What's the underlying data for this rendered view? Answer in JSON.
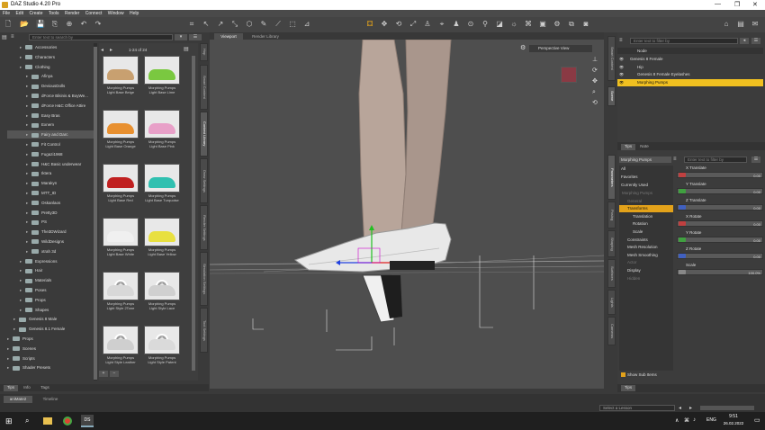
{
  "window": {
    "title": "DAZ Studio 4.20 Pro"
  },
  "menu": [
    "File",
    "Edit",
    "Create",
    "Tools",
    "Render",
    "Connect",
    "Window",
    "Help"
  ],
  "content_library": {
    "search_placeholder": "Enter text to search by",
    "tree": [
      {
        "label": "Accessories",
        "indent": 1,
        "sel": false
      },
      {
        "label": "Characters",
        "indent": 1,
        "sel": false
      },
      {
        "label": "Clothing",
        "indent": 1,
        "sel": false
      },
      {
        "label": "Afinya",
        "indent": 2,
        "sel": false
      },
      {
        "label": "DeviousDolls",
        "indent": 2,
        "sel": false
      },
      {
        "label": "dForce Bikinis & BoyWe...",
        "indent": 2,
        "sel": false
      },
      {
        "label": "dForce H&C Office Attire",
        "indent": 2,
        "sel": false
      },
      {
        "label": "Easy Bras",
        "indent": 2,
        "sel": false
      },
      {
        "label": "Exnem",
        "indent": 2,
        "sel": false
      },
      {
        "label": "Fairy and Darc",
        "indent": 2,
        "sel": true
      },
      {
        "label": "Fit Control",
        "indent": 2,
        "sel": false
      },
      {
        "label": "Fugazi1968",
        "indent": 2,
        "sel": false
      },
      {
        "label": "H&C Basic underwear",
        "indent": 2,
        "sel": false
      },
      {
        "label": "Iktera",
        "indent": 2,
        "sel": false
      },
      {
        "label": "Marakyn",
        "indent": 2,
        "sel": false
      },
      {
        "label": "MTT_ID",
        "indent": 2,
        "sel": false
      },
      {
        "label": "Oskanlaos",
        "indent": 2,
        "sel": false
      },
      {
        "label": "Pretty3D",
        "indent": 2,
        "sel": false
      },
      {
        "label": "PS",
        "indent": 2,
        "sel": false
      },
      {
        "label": "The3DWizard",
        "indent": 2,
        "sel": false
      },
      {
        "label": "WildDesigns",
        "indent": 2,
        "sel": false
      },
      {
        "label": "xtrah 3d",
        "indent": 2,
        "sel": false
      },
      {
        "label": "Expressions",
        "indent": 1,
        "sel": false
      },
      {
        "label": "Hair",
        "indent": 1,
        "sel": false
      },
      {
        "label": "Materials",
        "indent": 1,
        "sel": false
      },
      {
        "label": "Poses",
        "indent": 1,
        "sel": false
      },
      {
        "label": "Props",
        "indent": 1,
        "sel": false
      },
      {
        "label": "Shapes",
        "indent": 1,
        "sel": false
      },
      {
        "label": "Genesis 8 Male",
        "indent": 0,
        "sel": false
      },
      {
        "label": "Genesis 8.1 Female",
        "indent": 0,
        "sel": false
      },
      {
        "label": "Props",
        "indent": -1,
        "sel": false
      },
      {
        "label": "Scenes",
        "indent": -1,
        "sel": false
      },
      {
        "label": "Scripts",
        "indent": -1,
        "sel": false
      },
      {
        "label": "Shader Presets",
        "indent": -1,
        "sel": false
      }
    ],
    "page_info": "1-24 of 24",
    "items": [
      {
        "line1": "Morphing Pumps",
        "line2": "Light Base Beige",
        "color": "#c8a070"
      },
      {
        "line1": "Morphing Pumps",
        "line2": "Light Base Lime",
        "color": "#7ac840"
      },
      {
        "line1": "Morphing Pumps",
        "line2": "Light Base Orange",
        "color": "#e89030"
      },
      {
        "line1": "Morphing Pumps",
        "line2": "Light Base Pink",
        "color": "#e8a0c8"
      },
      {
        "line1": "Morphing Pumps",
        "line2": "Light Base Red",
        "color": "#c02020"
      },
      {
        "line1": "Morphing Pumps",
        "line2": "Light Base Turquoise",
        "color": "#30c0b0"
      },
      {
        "line1": "Morphing Pumps",
        "line2": "Light Base White",
        "color": "#f0f0f0"
      },
      {
        "line1": "Morphing Pumps",
        "line2": "Light Base Yellow",
        "color": "#e8e040"
      },
      {
        "line1": "Morphing Pumps",
        "line2": "Light Style 2Tone",
        "color": "#d8d8d8"
      },
      {
        "line1": "Morphing Pumps",
        "line2": "Light Style Lace",
        "color": "#d0d0d0"
      },
      {
        "line1": "Morphing Pumps",
        "line2": "Light Style Leather",
        "color": "#cfcfcf"
      },
      {
        "line1": "Morphing Pumps",
        "line2": "Light Style Patent",
        "color": "#dadada"
      }
    ],
    "bottom_tabs": [
      "Tips",
      "Info",
      "Tags"
    ]
  },
  "side_tabs_left": [
    "Smart Content",
    "Content Library",
    "Draw Settings",
    "Render Settings",
    "Simulation Settings",
    "Tool Settings"
  ],
  "viewport": {
    "tabs": [
      "Viewport",
      "Render Library"
    ],
    "view_label": "Perspective View"
  },
  "scene": {
    "search_placeholder": "Enter text to filter by",
    "header": "Node",
    "nodes": [
      {
        "label": "Genesis 8 Female",
        "indent": 0,
        "sel": false
      },
      {
        "label": "Hip",
        "indent": 1,
        "sel": false
      },
      {
        "label": "Genesis 8 Female Eyelashes",
        "indent": 1,
        "sel": false
      },
      {
        "label": "Morphing Pumps",
        "indent": 1,
        "sel": true
      }
    ],
    "tabs": [
      "Tips",
      "Note"
    ]
  },
  "parameters": {
    "node_selector": "Morphing Pumps",
    "search_placeholder": "Enter text to filter by",
    "categories": [
      "All",
      "Favorites",
      "Currently Used"
    ],
    "tree": [
      {
        "label": "Morphing Pumps",
        "indent": 0,
        "sel": false,
        "dim": true
      },
      {
        "label": "General",
        "indent": 1,
        "sel": false,
        "dim": true
      },
      {
        "label": "Transforms",
        "indent": 1,
        "sel": true,
        "dim": false
      },
      {
        "label": "Translation",
        "indent": 2,
        "sel": false,
        "dim": false
      },
      {
        "label": "Rotation",
        "indent": 2,
        "sel": false,
        "dim": false
      },
      {
        "label": "Scale",
        "indent": 2,
        "sel": false,
        "dim": false
      },
      {
        "label": "Constraints",
        "indent": 1,
        "sel": false,
        "dim": false
      },
      {
        "label": "Mesh Resolution",
        "indent": 1,
        "sel": false,
        "dim": false
      },
      {
        "label": "Mesh Smoothing",
        "indent": 1,
        "sel": false,
        "dim": false
      },
      {
        "label": "Actor",
        "indent": 1,
        "sel": false,
        "dim": true
      },
      {
        "label": "Display",
        "indent": 1,
        "sel": false,
        "dim": false
      },
      {
        "label": "Hidden",
        "indent": 1,
        "sel": false,
        "dim": true
      }
    ],
    "sliders": [
      {
        "label": "X Translate",
        "value": "0.00",
        "color": "#c04040"
      },
      {
        "label": "Y Translate",
        "value": "0.00",
        "color": "#40a040"
      },
      {
        "label": "Z Translate",
        "value": "0.00",
        "color": "#4060c0"
      },
      {
        "label": "X Rotate",
        "value": "0.00",
        "color": "#c04040"
      },
      {
        "label": "Y Rotate",
        "value": "0.00",
        "color": "#40a040"
      },
      {
        "label": "Z Rotate",
        "value": "0.00",
        "color": "#4060c0"
      },
      {
        "label": "Scale",
        "value": "100.0%",
        "color": "#888888"
      }
    ],
    "show_sub_items": "Show Sub Items",
    "tab": "Tips"
  },
  "side_tabs_right": [
    "Parameters",
    "Posing",
    "Shaping",
    "Surfaces",
    "Lights",
    "Cameras",
    "Scene"
  ],
  "bottom": {
    "tabs": [
      "aniMate2",
      "Timeline"
    ],
    "lesson_placeholder": "Select a Lesson"
  },
  "taskbar": {
    "time": "9:51",
    "date": "26.02.2022",
    "lang": "ENG"
  }
}
